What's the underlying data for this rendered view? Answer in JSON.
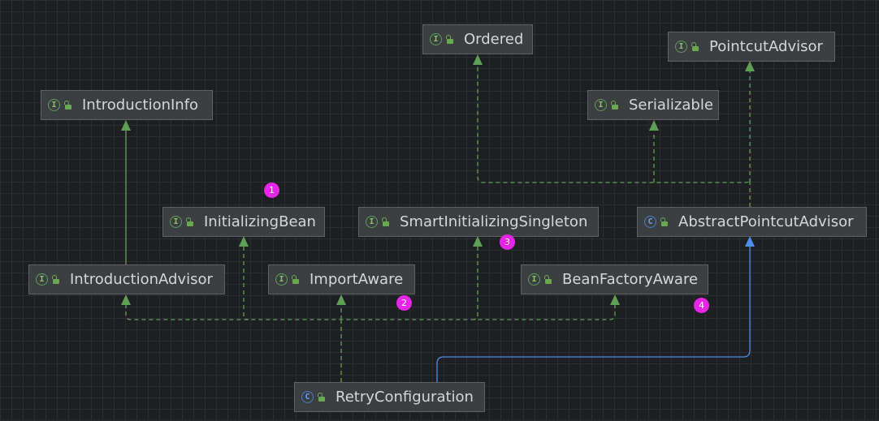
{
  "nodes": {
    "ordered": {
      "label": "Ordered",
      "kind": "interface"
    },
    "pointcut_advisor": {
      "label": "PointcutAdvisor",
      "kind": "interface"
    },
    "introduction_info": {
      "label": "IntroductionInfo",
      "kind": "interface"
    },
    "serializable": {
      "label": "Serializable",
      "kind": "interface"
    },
    "initializing_bean": {
      "label": "InitializingBean",
      "kind": "interface"
    },
    "smart_initializing_singleton": {
      "label": "SmartInitializingSingleton",
      "kind": "interface"
    },
    "abstract_pointcut_advisor": {
      "label": "AbstractPointcutAdvisor",
      "kind": "class"
    },
    "introduction_advisor": {
      "label": "IntroductionAdvisor",
      "kind": "interface"
    },
    "import_aware": {
      "label": "ImportAware",
      "kind": "interface"
    },
    "bean_factory_aware": {
      "label": "BeanFactoryAware",
      "kind": "interface"
    },
    "retry_configuration": {
      "label": "RetryConfiguration",
      "kind": "class"
    }
  },
  "badges": [
    "1",
    "2",
    "3",
    "4"
  ],
  "kind_glyphs": {
    "interface": "I",
    "class": "C"
  },
  "colors": {
    "background": "#1e1f22",
    "node_fill": "#3c3f41",
    "implements_edge": "#5e9f55",
    "extends_edge": "#4d8ee8",
    "badge": "#e625e6"
  }
}
